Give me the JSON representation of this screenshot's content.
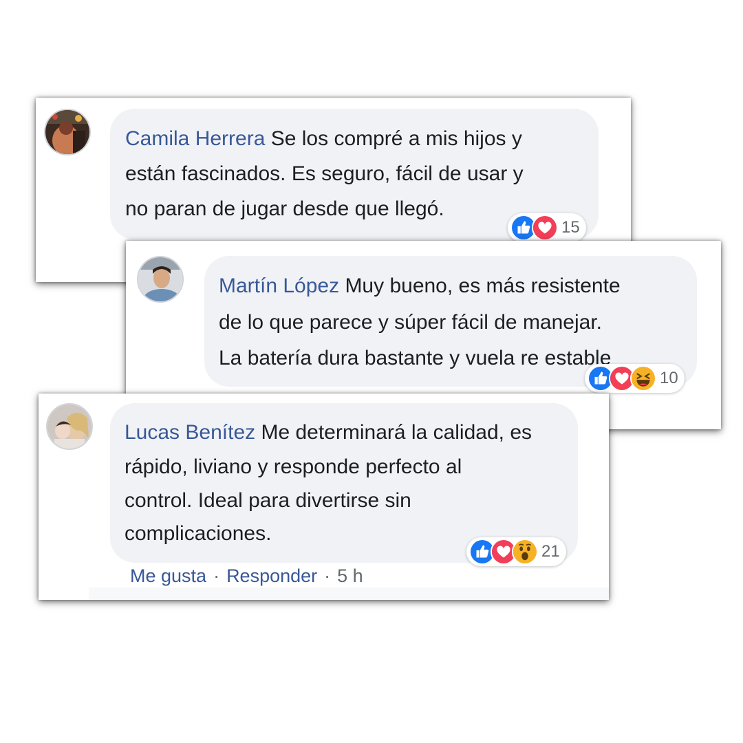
{
  "comments": [
    {
      "author": "Camila Herrera",
      "lines": [
        "Se los compré a mis hijos y",
        "están fascinados. Es seguro, fácil de usar y",
        "no paran de jugar desde que llegó."
      ],
      "reactions": [
        "like-icon",
        "love-icon"
      ],
      "reaction_count": "15"
    },
    {
      "author": "Martín López",
      "lines": [
        "Muy bueno, es más resistente",
        "de lo que parece y súper fácil de manejar.",
        "La batería dura bastante y vuela re estable"
      ],
      "reactions": [
        "like-icon",
        "love-icon",
        "haha-icon"
      ],
      "reaction_count": "10"
    },
    {
      "author": "Lucas Benítez",
      "lines": [
        "Me determinará la calidad, es",
        "rápido, liviano y responde perfecto al",
        "control. Ideal para divertirse sin",
        "complicaciones."
      ],
      "reactions": [
        "like-icon",
        "love-icon",
        "wow-icon"
      ],
      "reaction_count": "21",
      "actions": {
        "like_label": "Me gusta",
        "separator": "·",
        "reply_label": "Responder",
        "time": "5 h"
      }
    }
  ],
  "colors": {
    "name": "#385898",
    "bubble": "#f0f2f5",
    "like": "#1877f2",
    "love": "#f33e58",
    "emoji": "#f7b125"
  }
}
